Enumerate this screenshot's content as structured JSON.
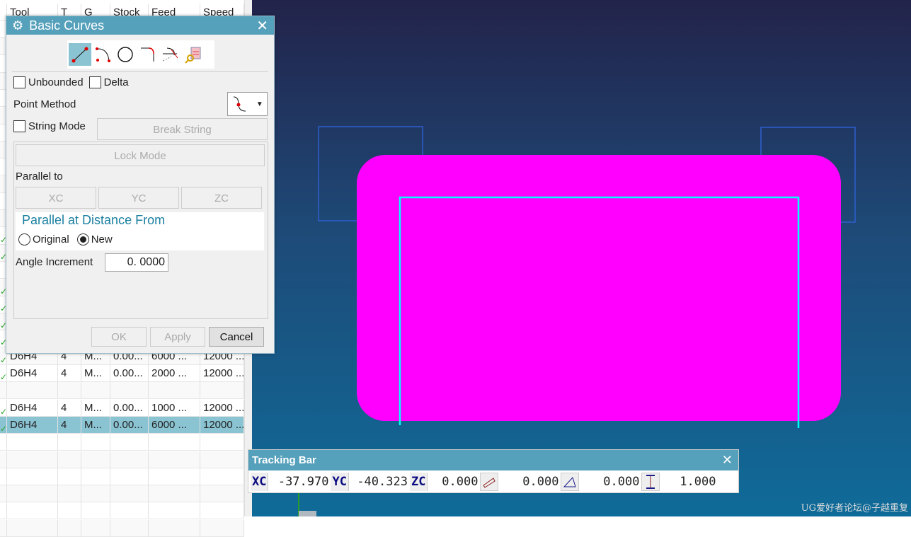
{
  "table": {
    "columns": [
      "",
      "Tool",
      "T",
      "G",
      "Stock",
      "Feed",
      "Speed"
    ],
    "rows": [
      {
        "check": true,
        "cells": [
          "D6H4",
          "4",
          "M...",
          "0.00...",
          "6000 ...",
          "12000 ..."
        ]
      },
      {
        "check": true,
        "cells": [
          "D6H4",
          "4",
          "M...",
          "0.00...",
          "2000 ...",
          "12000 ..."
        ]
      },
      {
        "check": false,
        "cells": [
          "",
          "",
          "",
          "",
          "",
          ""
        ]
      },
      {
        "check": true,
        "cells": [
          "D6H4",
          "4",
          "M...",
          "0.00...",
          "1000 ...",
          "12000 ..."
        ]
      },
      {
        "check": true,
        "selected": true,
        "cells": [
          "D6H4",
          "4",
          "M...",
          "0.00...",
          "6000 ...",
          "12000 ..."
        ]
      }
    ]
  },
  "dialog": {
    "title": "Basic Curves",
    "toolbar": [
      "line-icon",
      "arc-icon",
      "circle-icon",
      "fillet-icon",
      "trim-icon",
      "edit-parameters-icon"
    ],
    "unbounded": "Unbounded",
    "delta": "Delta",
    "point_method": "Point Method",
    "string_mode": "String Mode",
    "break_string": "Break String",
    "lock_mode": "Lock Mode",
    "parallel_to": "Parallel to",
    "xc": "XC",
    "yc": "YC",
    "zc": "ZC",
    "parallel_at": "Parallel at Distance From",
    "original": "Original",
    "new": "New",
    "selected_option": "New",
    "angle_increment": "Angle Increment",
    "angle_value": "0. 0000",
    "ok": "OK",
    "apply": "Apply",
    "cancel": "Cancel"
  },
  "tracking": {
    "title": "Tracking Bar",
    "xc_label": "XC",
    "xc": "-37.970",
    "yc_label": "YC",
    "yc": "-40.323",
    "zc_label": "ZC",
    "zc": "0.000",
    "length": "0.000",
    "angle": "0.000",
    "offset": "1.000"
  },
  "watermark": "UG爱好者论坛@子越重复",
  "colors": {
    "accent": "#55a0bb",
    "shape": "#ff00ff",
    "path": "#00ffff",
    "outline": "#2f5fd0"
  }
}
